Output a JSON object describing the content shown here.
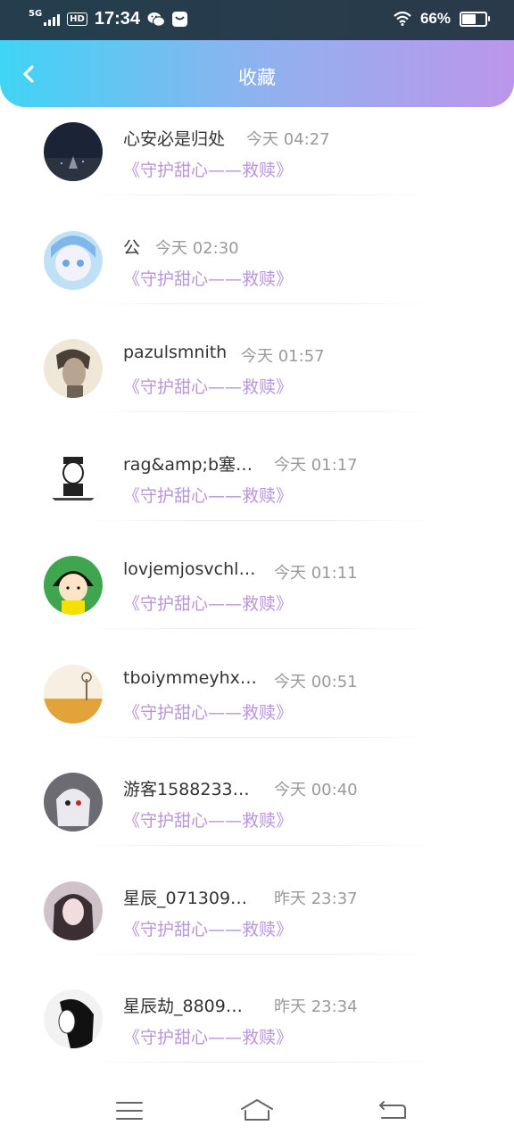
{
  "status_bar": {
    "network": "5G",
    "hd": "HD",
    "time": "17:34",
    "battery_percent": "66%",
    "battery_level": 0.66,
    "icons": [
      "signal-icon",
      "hd-icon",
      "wechat-icon",
      "message-icon",
      "wifi-icon",
      "battery-icon"
    ]
  },
  "header": {
    "title": "收藏",
    "back_icon": "chevron-left-icon"
  },
  "colors": {
    "accent_purple": "#b995da",
    "header_start": "#3fd4f5",
    "header_end": "#bc96ea"
  },
  "items": [
    {
      "name": "心安必是归处",
      "time": "今天 04:27",
      "book": "《守护甜心——救赎》"
    },
    {
      "name": "公",
      "time": "今天 02:30",
      "book": "《守护甜心——救赎》"
    },
    {
      "name": "pazulsmnith",
      "time": "今天 01:57",
      "book": "《守护甜心——救赎》"
    },
    {
      "name": "rag&amp;b塞…",
      "time": "今天 01:17",
      "book": "《守护甜心——救赎》"
    },
    {
      "name": "lovjemjosvchl…",
      "time": "今天 01:11",
      "book": "《守护甜心——救赎》"
    },
    {
      "name": "tboiymmeyhx…",
      "time": "今天 00:51",
      "book": "《守护甜心——救赎》"
    },
    {
      "name": "游客1588233…",
      "time": "今天 00:40",
      "book": "《守护甜心——救赎》"
    },
    {
      "name": "星辰_071309…",
      "time": "昨天 23:37",
      "book": "《守护甜心——救赎》"
    },
    {
      "name": "星辰劫_8809…",
      "time": "昨天 23:34",
      "book": "《守护甜心——救赎》"
    }
  ],
  "nav": {
    "icons": [
      "menu-icon",
      "home-icon",
      "back-icon"
    ]
  }
}
